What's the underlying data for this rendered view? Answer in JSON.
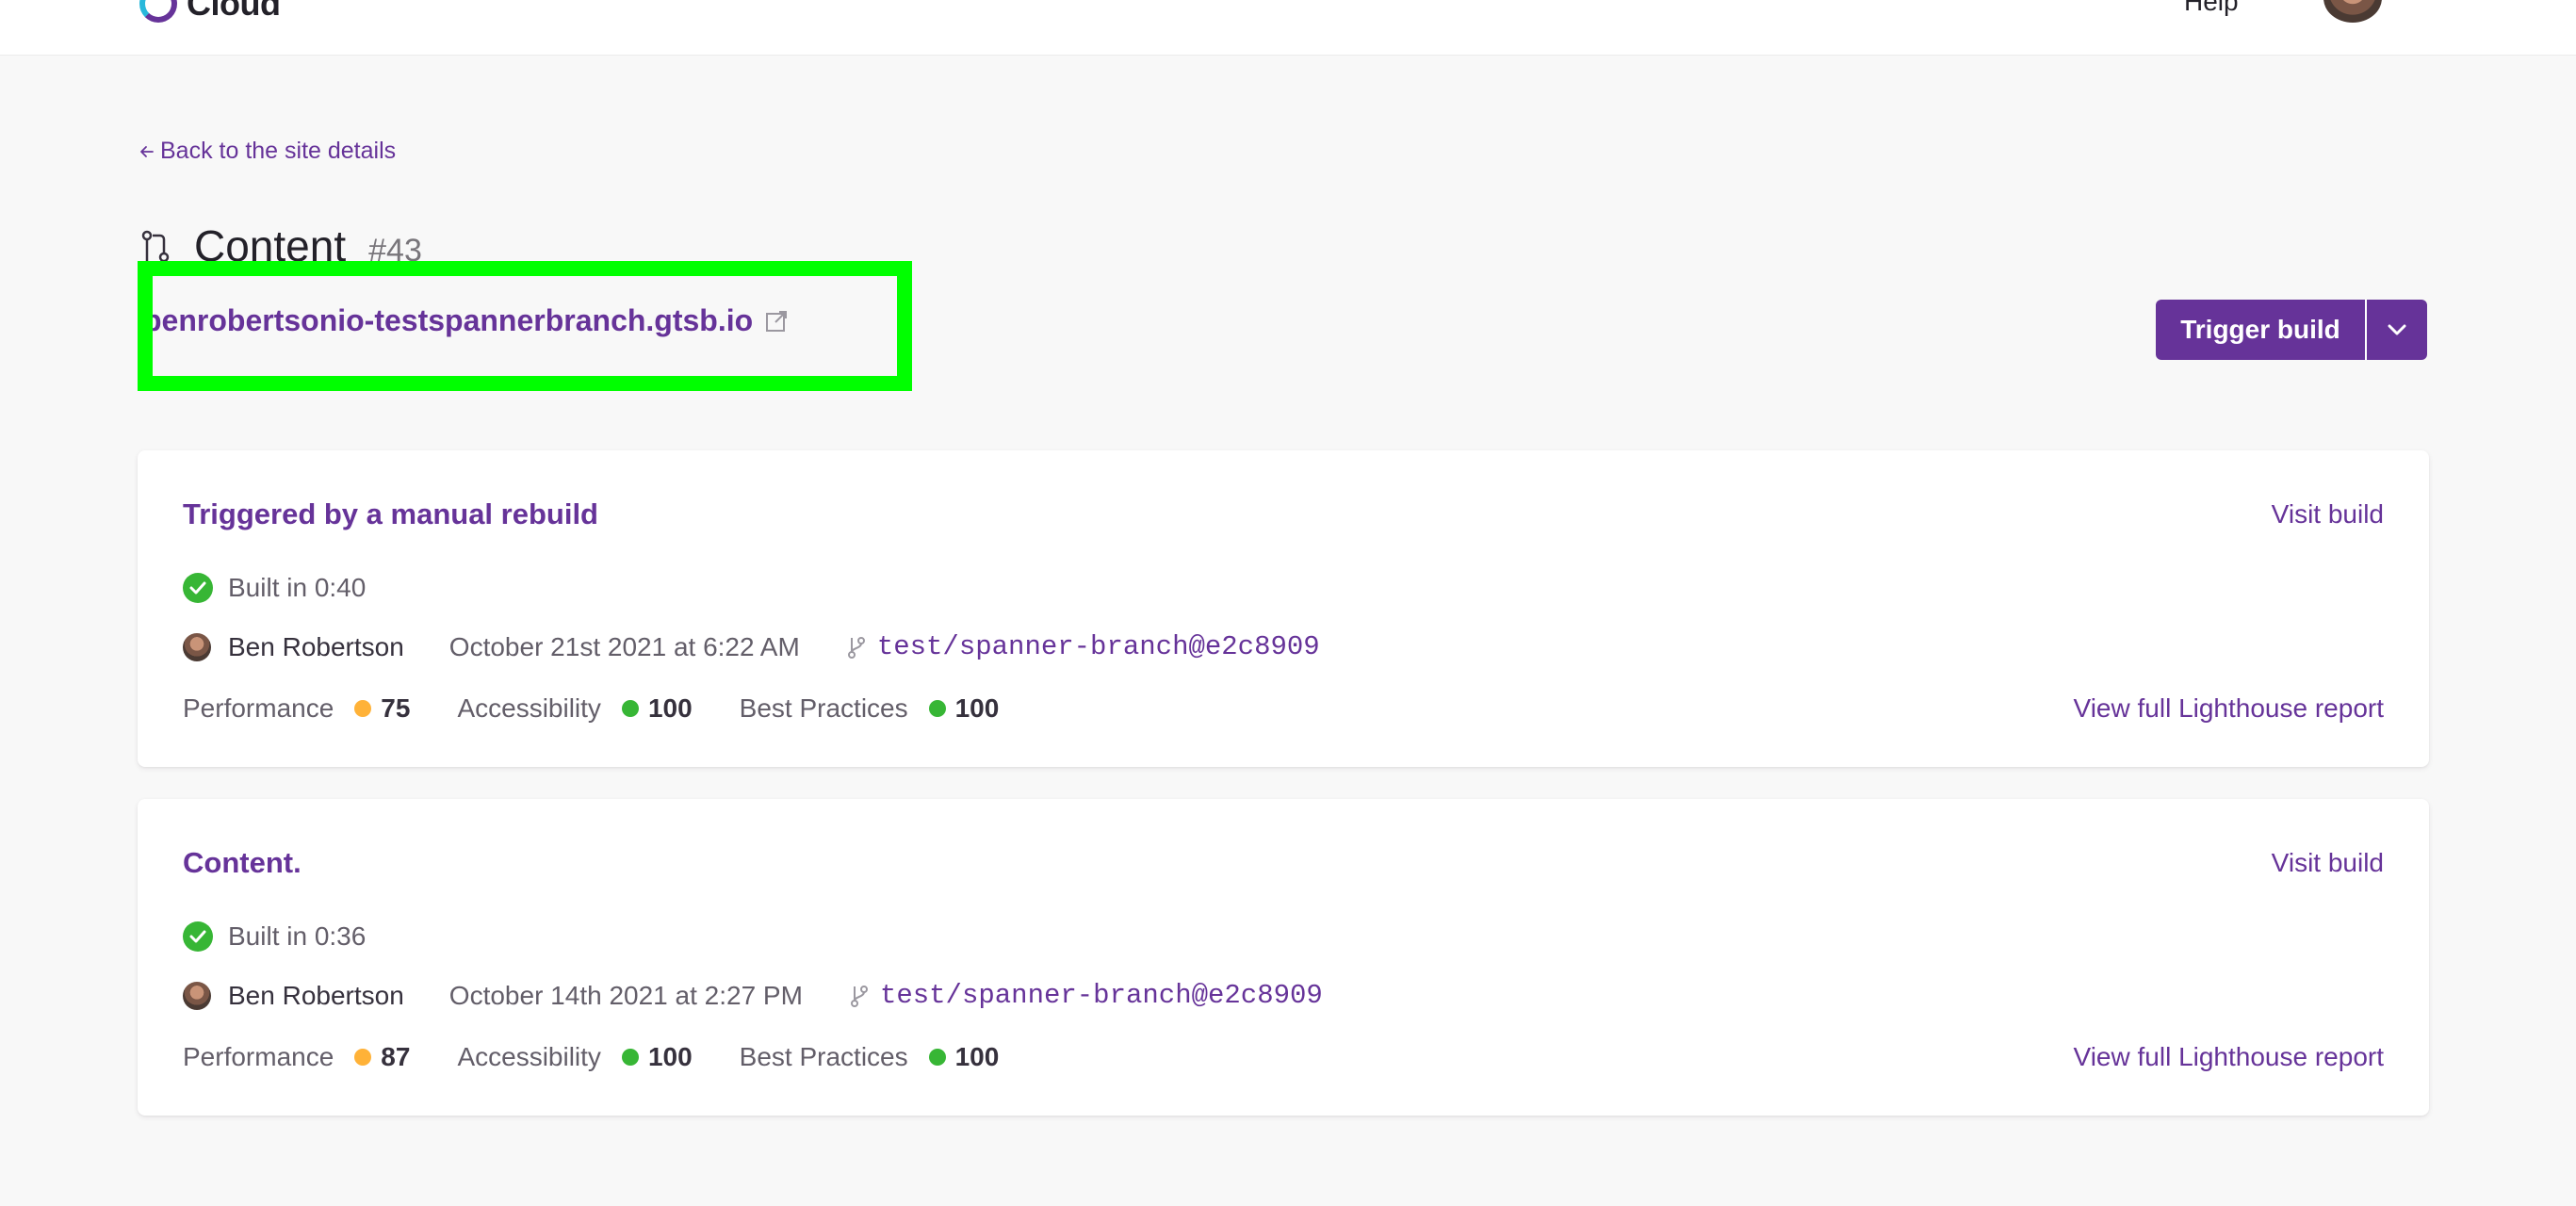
{
  "header": {
    "logo_text": "Cloud",
    "help_label": "Help"
  },
  "back_link": "Back to the site details",
  "page": {
    "title": "Content",
    "build_number": "#43",
    "site_url": "benrobertsonio-testspannerbranch.gtsb.io",
    "trigger_label": "Trigger build"
  },
  "colors": {
    "accent": "#663399",
    "success": "#37b635",
    "warning": "#ffb238",
    "highlight": "#00ff00"
  },
  "builds": [
    {
      "title": "Triggered by a manual rebuild",
      "visit_label": "Visit build",
      "built_in": "Built in 0:40",
      "author": "Ben Robertson",
      "date": "October 21st 2021 at 6:22 AM",
      "commit": "test/spanner-branch@e2c8909",
      "scores": [
        {
          "label": "Performance",
          "value": "75",
          "color": "#ffb238"
        },
        {
          "label": "Accessibility",
          "value": "100",
          "color": "#37b635"
        },
        {
          "label": "Best Practices",
          "value": "100",
          "color": "#37b635"
        }
      ],
      "lighthouse_label": "View full Lighthouse report"
    },
    {
      "title": "Content.",
      "visit_label": "Visit build",
      "built_in": "Built in 0:36",
      "author": "Ben Robertson",
      "date": "October 14th 2021 at 2:27 PM",
      "commit": "test/spanner-branch@e2c8909",
      "scores": [
        {
          "label": "Performance",
          "value": "87",
          "color": "#ffb238"
        },
        {
          "label": "Accessibility",
          "value": "100",
          "color": "#37b635"
        },
        {
          "label": "Best Practices",
          "value": "100",
          "color": "#37b635"
        }
      ],
      "lighthouse_label": "View full Lighthouse report"
    }
  ]
}
